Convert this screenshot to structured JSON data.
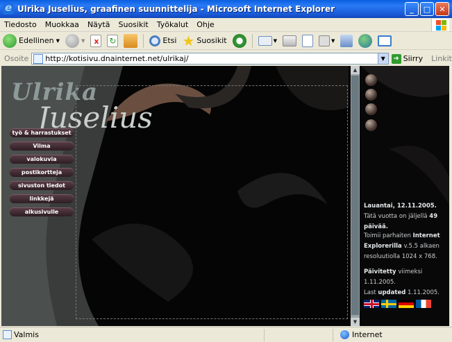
{
  "window": {
    "title": "Ulrika Juselius, graafinen suunnittelija - Microsoft Internet Explorer",
    "minimize": "_",
    "maximize": "□",
    "close": "✕"
  },
  "menu": {
    "items": [
      "Tiedosto",
      "Muokkaa",
      "Näytä",
      "Suosikit",
      "Työkalut",
      "Ohje"
    ]
  },
  "toolbar": {
    "back_label": "Edellinen",
    "search_label": "Etsi",
    "favorites_label": "Suosikit"
  },
  "address": {
    "label": "Osoite",
    "url": "http://kotisivu.dnainternet.net/ulrikaj/",
    "go_label": "Siirry",
    "links_label": "Linkit"
  },
  "site": {
    "logo_top": "Ulrika",
    "logo_bottom": "Juselius",
    "nav": [
      "työ & harrastukset",
      "Vilma",
      "valokuvia",
      "postikortteja",
      "sivuston tiedot",
      "linkkejä",
      "alkusivulle"
    ],
    "date_line": "Lauantai, 12.11.2005.",
    "days_pre": "Tätä vuotta on jäljellä",
    "days_count": "49",
    "days_post": "päivää.",
    "works_pre": "Toimii parhaiten",
    "works_bold1": "Internet Explorerilla",
    "works_post": "v.5.5 alkaen resoluutiolla 1024 x 768.",
    "updated_bold": "Päivitetty",
    "updated_text": "viimeksi 1.11.2005.",
    "last_pre": "Last",
    "last_bold": "updated",
    "last_date": "1.11.2005."
  },
  "statusbar": {
    "status": "Valmis",
    "zone": "Internet"
  },
  "colors": {
    "titlebar": "#1958d6",
    "page_bg": "#050505",
    "nav_button": "#4a2f38"
  }
}
